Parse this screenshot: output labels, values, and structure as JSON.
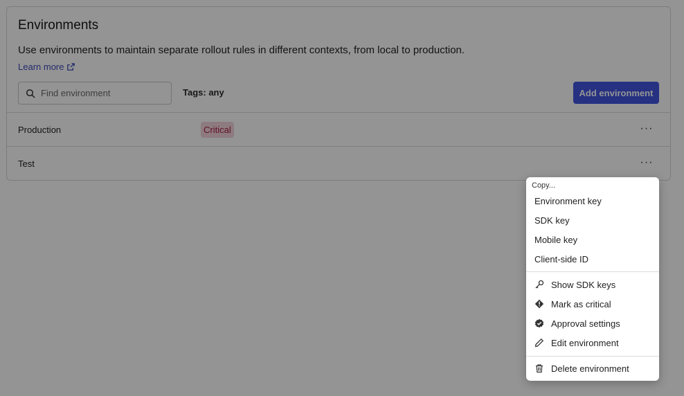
{
  "panel": {
    "title": "Environments",
    "description": "Use environments to maintain separate rollout rules in different contexts, from local to production.",
    "learn_more": "Learn more",
    "search_placeholder": "Find environment",
    "tags_filter": "Tags: any",
    "add_button": "Add environment"
  },
  "rows": [
    {
      "name": "Production",
      "badge": "Critical",
      "menu": "···"
    },
    {
      "name": "Test",
      "menu": "···"
    }
  ],
  "dropdown": {
    "heading": "Copy...",
    "copy_items": [
      "Environment key",
      "SDK key",
      "Mobile key",
      "Client-side ID"
    ],
    "actions": [
      {
        "label": "Show SDK keys",
        "icon": "key-icon"
      },
      {
        "label": "Mark as critical",
        "icon": "alert-diamond-icon"
      },
      {
        "label": "Approval settings",
        "icon": "check-badge-icon"
      },
      {
        "label": "Edit environment",
        "icon": "pencil-icon"
      }
    ],
    "danger": {
      "label": "Delete environment",
      "icon": "trash-icon"
    }
  },
  "colors": {
    "accent": "#4355e0",
    "link": "#3d4ab8",
    "badge_bg": "#f3d4dc",
    "badge_text": "#a51d3d"
  }
}
